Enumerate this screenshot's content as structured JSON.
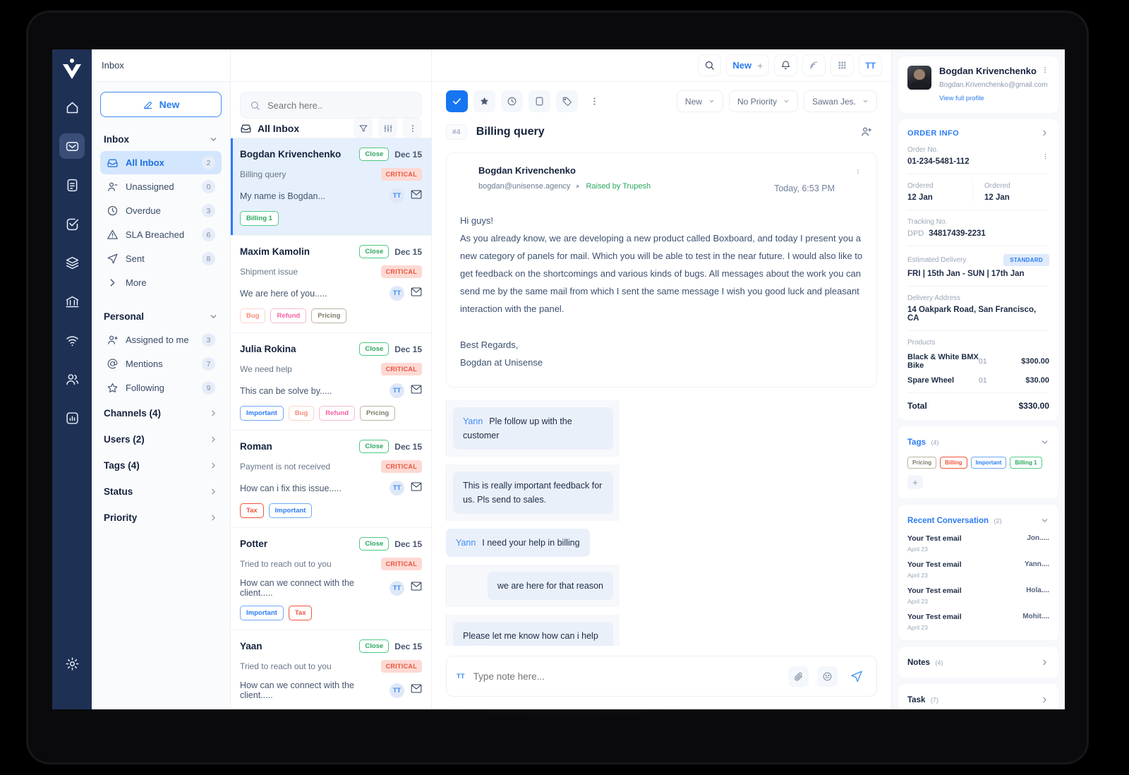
{
  "header": {
    "title": "Inbox",
    "search_icon": "search-icon",
    "new_label": "New",
    "new_plus": "+",
    "bell_icon": "bell-icon",
    "broadcast_icon": "broadcast-icon",
    "grid_icon": "grid-apps-icon",
    "avatar_initials": "TT"
  },
  "rail": {
    "logo": "app-logo",
    "items": [
      {
        "name": "home-icon",
        "active": false
      },
      {
        "name": "mail-icon",
        "active": true
      },
      {
        "name": "document-icon",
        "active": false
      },
      {
        "name": "tasks-check-icon",
        "active": false
      },
      {
        "name": "layers-icon",
        "active": false
      },
      {
        "name": "bank-icon",
        "active": false
      },
      {
        "name": "wifi-icon",
        "active": false
      },
      {
        "name": "contacts-icon",
        "active": false
      },
      {
        "name": "reports-chart-icon",
        "active": false
      }
    ],
    "settings_icon": "gear-icon"
  },
  "nav": {
    "new_button": "New",
    "groups": [
      {
        "label": "Inbox",
        "items": [
          {
            "icon": "inbox-icon",
            "label": "All Inbox",
            "count": "2",
            "selected": true
          },
          {
            "icon": "user-minus-icon",
            "label": "Unassigned",
            "count": "0",
            "selected": false
          },
          {
            "icon": "clock-icon",
            "label": "Overdue",
            "count": "3",
            "selected": false
          },
          {
            "icon": "alert-icon",
            "label": "SLA Breached",
            "count": "6",
            "selected": false
          },
          {
            "icon": "send-icon",
            "label": "Sent",
            "count": "8",
            "selected": false
          }
        ],
        "more_label": "More"
      },
      {
        "label": "Personal",
        "items": [
          {
            "icon": "user-plus-icon",
            "label": "Assigned to me",
            "count": "3",
            "selected": false
          },
          {
            "icon": "at-icon",
            "label": "Mentions",
            "count": "7",
            "selected": false
          },
          {
            "icon": "star-icon",
            "label": "Following",
            "count": "9",
            "selected": false
          }
        ]
      }
    ],
    "sections": [
      {
        "label": "Channels (4)"
      },
      {
        "label": "Users (2)"
      },
      {
        "label": "Tags (4)"
      },
      {
        "label": "Status"
      },
      {
        "label": "Priority"
      }
    ]
  },
  "list": {
    "search_placeholder": "Search here..",
    "search_value": "",
    "header_title": "All Inbox",
    "filter_icon": "filter-icon",
    "sort_icon": "sort-icon",
    "more_icon": "kebab-icon",
    "conversations": [
      {
        "name": "Bogdan Krivenchenko",
        "status": "Close",
        "date": "Dec 15",
        "subject": "Billing query",
        "priority": "CRITICAL",
        "snippet": "My name is Bogdan...",
        "avatar": "TT",
        "tags": [
          {
            "label": "Billing 1",
            "cls": "billing1"
          }
        ],
        "active": true
      },
      {
        "name": "Maxim Kamolin",
        "status": "Close",
        "date": "Dec 15",
        "subject": "Shipment issue",
        "priority": "CRITICAL",
        "snippet": "We are here of you.....",
        "avatar": "TT",
        "tags": [
          {
            "label": "Bug",
            "cls": "bug"
          },
          {
            "label": "Refund",
            "cls": "refund"
          },
          {
            "label": "Pricing",
            "cls": "pricing"
          }
        ],
        "active": false
      },
      {
        "name": "Julia Rokina",
        "status": "Close",
        "date": "Dec 15",
        "subject": "We need help",
        "priority": "CRITICAL",
        "snippet": "This can be solve by.....",
        "avatar": "TT",
        "tags": [
          {
            "label": "Important",
            "cls": "important"
          },
          {
            "label": "Bug",
            "cls": "bug"
          },
          {
            "label": "Refund",
            "cls": "refund"
          },
          {
            "label": "Pricing",
            "cls": "pricing"
          }
        ],
        "active": false
      },
      {
        "name": "Roman",
        "status": "Close",
        "date": "Dec 15",
        "subject": "Payment is not received",
        "priority": "CRITICAL",
        "snippet": "How can i fix this issue.....",
        "avatar": "TT",
        "tags": [
          {
            "label": "Tax",
            "cls": "tax"
          },
          {
            "label": "Important",
            "cls": "important"
          }
        ],
        "active": false
      },
      {
        "name": "Potter",
        "status": "Close",
        "date": "Dec 15",
        "subject": "Tried to reach out to you",
        "priority": "CRITICAL",
        "snippet": "How can we connect with the client.....",
        "avatar": "TT",
        "tags": [
          {
            "label": "Important",
            "cls": "important"
          },
          {
            "label": "Tax",
            "cls": "tax"
          }
        ],
        "active": false
      },
      {
        "name": "Yaan",
        "status": "Close",
        "date": "Dec 15",
        "subject": "Tried to reach out to you",
        "priority": "CRITICAL",
        "snippet": "How can we connect with the client.....",
        "avatar": "TT",
        "tags": [],
        "active": false
      }
    ]
  },
  "conversation": {
    "tools": [
      {
        "name": "resolve-check-icon",
        "primary": true
      },
      {
        "name": "star-icon",
        "primary": false
      },
      {
        "name": "snooze-clock-icon",
        "primary": false
      },
      {
        "name": "folder-icon",
        "primary": false
      },
      {
        "name": "tag-icon",
        "primary": false
      },
      {
        "name": "kebab-icon",
        "primary": false
      }
    ],
    "dropdowns": [
      {
        "label": "New"
      },
      {
        "label": "No Priority"
      },
      {
        "label": "Sawan Jes."
      }
    ],
    "ticket_no": "#4",
    "title": "Billing query",
    "assign_icon": "assign-user-icon",
    "mail": {
      "sender": "Bogdan Krivenchenko",
      "email": "bogdan@unisense.agency",
      "raised_by": "Raised by Trupesh",
      "time": "Today, 6:53 PM",
      "greeting": "Hi guys!",
      "paragraph": "As you already know, we are developing a new product called Boxboard, and today I present you a new category of panels for mail. Which you will be able to test in the near future. I would also like to get feedback on the shortcomings and various kinds of bugs. All messages about the work you can send me by the same mail from which I sent the same message I wish you good luck and pleasant interaction with the panel.",
      "sign_off": "Best Regards,",
      "signature": "Bogdan at Unisense"
    },
    "messages": [
      {
        "side": "right",
        "who": "Yann",
        "text": "Ple follow up with the customer"
      },
      {
        "side": "right",
        "who": "",
        "text": "This is really important feedback for us. Pls send to sales."
      },
      {
        "side": "left",
        "who": "Yann",
        "text": "I need your help in billing"
      },
      {
        "side": "right",
        "who": "",
        "text": "we are here for that reason"
      },
      {
        "side": "right",
        "who": "",
        "text": "Please let me know how can i help you and what kind of issue you are facing"
      }
    ],
    "composer": {
      "avatar": "TT",
      "placeholder": "Type note here...",
      "value": "",
      "attach_icon": "paperclip-icon",
      "emoji_icon": "emoji-icon",
      "send_icon": "send-icon"
    }
  },
  "details": {
    "profile": {
      "name": "Bogdan Krivenchenko",
      "email": "Bogdan.Krivenchenko@gmail.com",
      "view_profile": "View full profile",
      "kebab_icon": "kebab-icon"
    },
    "order_info": {
      "title": "ORDER INFO",
      "order_no_label": "Order No.",
      "order_no_value": "01-234-5481-112",
      "ordered_label_1": "Ordered",
      "ordered_value_1": "12 Jan",
      "ordered_label_2": "Ordered",
      "ordered_value_2": "12 Jan",
      "tracking_label": "Tracking No.",
      "tracking_carrier": "DPD",
      "tracking_value": "34817439-2231",
      "delivery_label": "Estimated Delivery",
      "delivery_badge": "STANDARD",
      "delivery_value": "FRI  |  15th Jan - SUN  |  17th Jan",
      "address_label": "Delivery Address",
      "address_value": "14 Oakpark Road, San Francisco, CA",
      "products_label": "Products",
      "products": [
        {
          "name": "Black & White BMX Bike",
          "qty": "01",
          "price": "$300.00"
        },
        {
          "name": "Spare Wheel",
          "qty": "01",
          "price": "$30.00"
        }
      ],
      "total_label": "Total",
      "total_value": "$330.00"
    },
    "tags": {
      "title": "Tags",
      "count": "(4)",
      "items": [
        {
          "label": "Pricing",
          "cls": "pricing"
        },
        {
          "label": "Billing",
          "cls": "billing"
        },
        {
          "label": "Important",
          "cls": "important"
        },
        {
          "label": "Billing 1",
          "cls": "billing1"
        }
      ],
      "add_label": "+"
    },
    "recent": {
      "title": "Recent Conversation",
      "count": "(2)",
      "items": [
        {
          "title": "Your Test email",
          "date": "April 23",
          "right": "Jon....."
        },
        {
          "title": "Your Test email",
          "date": "April 23",
          "right": "Yann...."
        },
        {
          "title": "Your Test email",
          "date": "April 23",
          "right": "Hola...."
        },
        {
          "title": "Your Test email",
          "date": "April 23",
          "right": "Mohit...."
        }
      ]
    },
    "notes": {
      "title": "Notes",
      "count": "(4)"
    },
    "task": {
      "title": "Task",
      "count": "(7)"
    }
  },
  "colors": {
    "rail_bg": "#1e3155",
    "accent": "#2b7cf0",
    "accent_strong": "#1675f0",
    "selected_nav": "#d3e6fd",
    "selected_conv": "#e6effc",
    "green": "#2aa85e",
    "critical_bg": "#fdd9d4",
    "critical_text": "#e8553c",
    "panel_bg": "#f6f8fb"
  }
}
